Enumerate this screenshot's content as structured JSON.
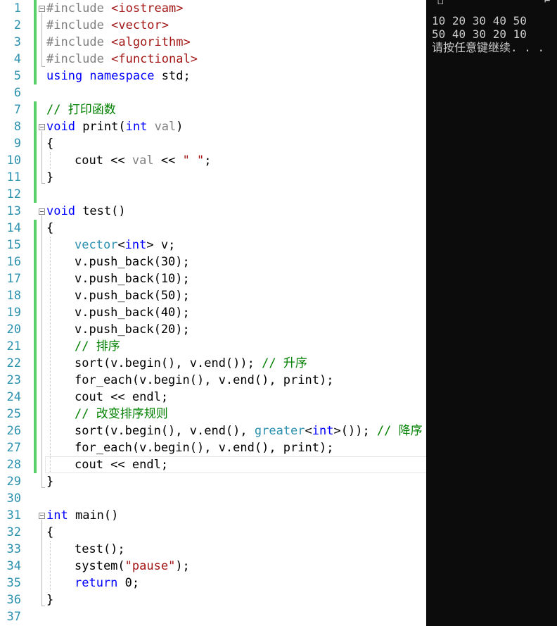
{
  "editor": {
    "line_numbers": [
      "1",
      "2",
      "3",
      "4",
      "5",
      "6",
      "7",
      "8",
      "9",
      "10",
      "11",
      "12",
      "13",
      "14",
      "15",
      "16",
      "17",
      "18",
      "19",
      "20",
      "21",
      "22",
      "23",
      "24",
      "25",
      "26",
      "27",
      "28",
      "29",
      "30",
      "31",
      "32",
      "33",
      "34",
      "35",
      "36",
      "37"
    ],
    "code": {
      "l1_pp": "#include ",
      "l1_hdr": "<iostream>",
      "l2_pp": "#include ",
      "l2_hdr": "<vector>",
      "l3_pp": "#include ",
      "l3_hdr": "<algorithm>",
      "l4_pp": "#include ",
      "l4_hdr": "<functional>",
      "l5_kw": "using namespace",
      "l5_rest": " std;",
      "l7_cm": "// 打印函数",
      "l8_kw": "void",
      "l8_fn": " print(",
      "l8_ty": "int",
      "l8_pm": " val",
      "l8_end": ")",
      "l9": "{",
      "l10_a": "cout << ",
      "l10_pm": "val",
      "l10_b": " << ",
      "l10_st": "\" \"",
      "l10_c": ";",
      "l11": "}",
      "l13_kw": "void",
      "l13_rest": " test()",
      "l14": "{",
      "l15_ty": "vector",
      "l15_a": "<",
      "l15_ty2": "int",
      "l15_b": "> v;",
      "l16": "v.push_back(30);",
      "l17": "v.push_back(10);",
      "l18": "v.push_back(50);",
      "l19": "v.push_back(40);",
      "l20": "v.push_back(20);",
      "l21_cm": "// 排序",
      "l22_a": "sort(v.begin(), v.end()); ",
      "l22_cm": "// 升序",
      "l23": "for_each(v.begin(), v.end(), print);",
      "l24": "cout << endl;",
      "l25_cm": "// 改变排序规则",
      "l26_a": "sort(v.begin(), v.end(), ",
      "l26_ty": "greater",
      "l26_b": "<",
      "l26_ty2": "int",
      "l26_c": ">()); ",
      "l26_cm": "// 降序",
      "l27": "for_each(v.begin(), v.end(), print);",
      "l28": "cout << endl;",
      "l29": "}",
      "l31_kw": "int",
      "l31_rest": " main()",
      "l32": "{",
      "l33": "test();",
      "l34_a": "system(",
      "l34_st": "\"pause\"",
      "l34_b": ");",
      "l35_kw": "return",
      "l35_rest": " 0;",
      "l36": "}"
    }
  },
  "console": {
    "lines": [
      "10 20 30 40 50",
      "50 40 30 20 10",
      "请按任意键继续. . ."
    ]
  },
  "colors": {
    "line_number": "#2b91af",
    "keyword": "#0000ff",
    "type": "#2b91af",
    "string": "#a31515",
    "comment": "#008000",
    "change_bar": "#57d06a",
    "console_bg": "#0c0c0c",
    "console_text": "#cccccc"
  }
}
